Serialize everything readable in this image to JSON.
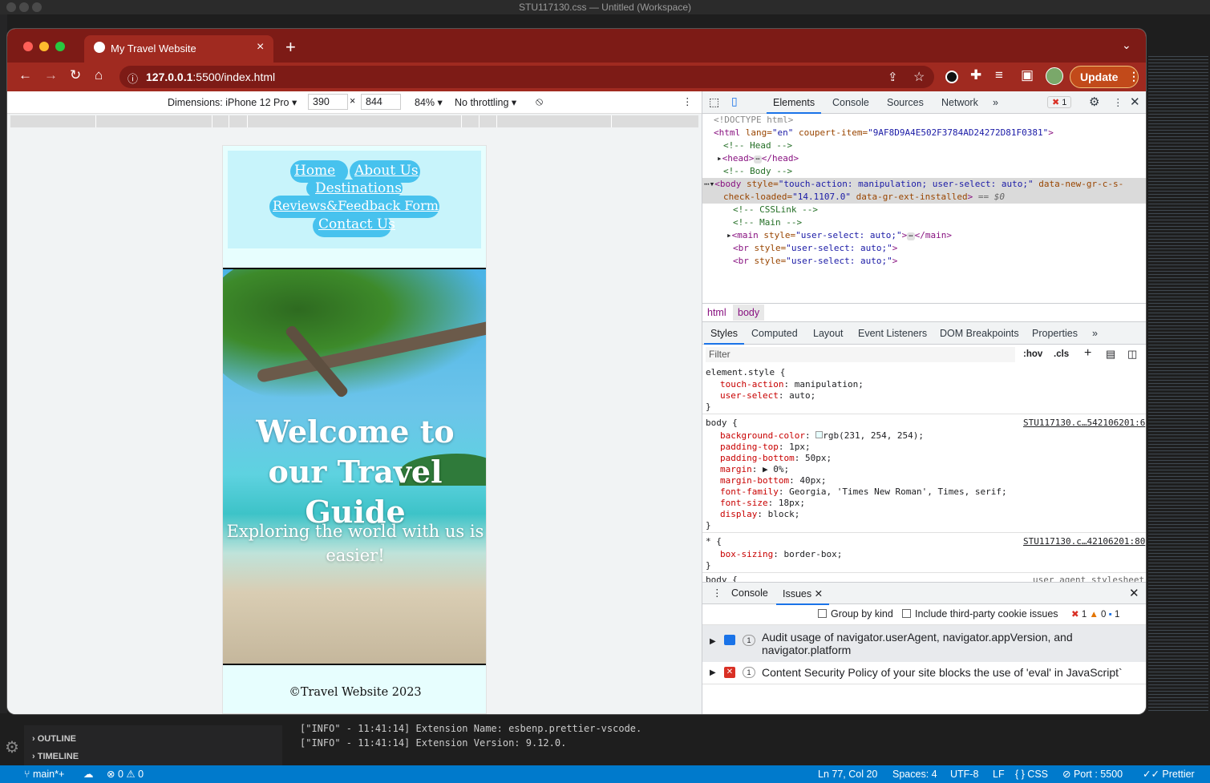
{
  "vscode": {
    "window_title": "STU117130.css — Untitled (Workspace)",
    "outline_label": "OUTLINE",
    "timeline_label": "TIMELINE",
    "terminal_lines": [
      "[\"INFO\" - 11:41:14] Extension Name: esbenp.prettier-vscode.",
      "[\"INFO\" - 11:41:14] Extension Version: 9.12.0."
    ],
    "status": {
      "branch": "main*+",
      "problems": "0",
      "warnings": "0",
      "position": "Ln 77, Col 20",
      "spaces": "Spaces: 4",
      "encoding": "UTF-8",
      "eol": "LF",
      "language": "CSS",
      "port": "Port : 5500",
      "formatter": "Prettier"
    }
  },
  "browser": {
    "tab_title": "My Travel Website",
    "url_host": "127.0.0.1",
    "url_rest": ":5500/index.html",
    "update_label": "Update",
    "device": {
      "dimensions_label": "Dimensions: iPhone 12 Pro",
      "width": "390",
      "height": "844",
      "zoom": "84%",
      "throttling": "No throttling"
    }
  },
  "site": {
    "nav": {
      "home": "Home",
      "about": "About Us",
      "destinations": "Destinations",
      "reviews": "Reviews&Feedback Form",
      "contact": "Contact Us"
    },
    "hero_title": "Welcome to our Travel Guide",
    "hero_subtitle": "Exploring the world with us is easier!",
    "footer": "©Travel Website 2023"
  },
  "devtools": {
    "tabs": [
      "Elements",
      "Console",
      "Sources",
      "Network"
    ],
    "error_count": "1",
    "dom": {
      "doctype": "<!DOCTYPE html>",
      "html_open_tag": "<html",
      "html_lang_attr": " lang=",
      "html_lang_val": "\"en\"",
      "html_coupert_attr": " coupert-item=",
      "html_coupert_val": "\"9AF8D9A4E502F3784AD24272D81F0381\"",
      "html_close": ">",
      "comment_head": "<!-- Head -->",
      "head_open": "<head>",
      "head_close": "</head>",
      "comment_body": "<!-- Body -->",
      "body_open": "<body",
      "body_style_attr": " style=",
      "body_style_val": "\"touch-action: manipulation; user-select: auto;\"",
      "body_gr_attr": " data-new-gr-c-s-",
      "body_gr_attr2": "check-loaded=",
      "body_gr_val": "\"14.1107.0\"",
      "body_ext_attr": " data-gr-ext-installed",
      "body_close": ">",
      "body_eq": " == $0",
      "comment_css": "<!-- CSSLink -->",
      "comment_main": "<!-- Main -->",
      "main_open": "<main",
      "main_style_attr": " style=",
      "main_style_val": "\"user-select: auto;\"",
      "main_close_bracket": ">",
      "main_close_tag": "</main>",
      "br_open": "<br",
      "br_style_attr": " style=",
      "br_style_val": "\"user-select: auto;\"",
      "br_close": ">"
    },
    "breadcrumbs": [
      "html",
      "body"
    ],
    "style_tabs": [
      "Styles",
      "Computed",
      "Layout",
      "Event Listeners",
      "DOM Breakpoints",
      "Properties"
    ],
    "filter_placeholder": "Filter",
    "hov": ":hov",
    "cls": ".cls",
    "rules": {
      "element_selector": "element.style {",
      "element_props": [
        {
          "name": "touch-action",
          "value": "manipulation;"
        },
        {
          "name": "user-select",
          "value": "auto;"
        }
      ],
      "body_selector": "body {",
      "body_source": "STU117130.c…542106201:6",
      "body_props": [
        {
          "name": "background-color",
          "value": "rgb(231, 254, 254);"
        },
        {
          "name": "padding-top",
          "value": "1px;"
        },
        {
          "name": "padding-bottom",
          "value": "50px;"
        },
        {
          "name": "margin",
          "value": "▶ 0%;"
        },
        {
          "name": "margin-bottom",
          "value": "40px;"
        },
        {
          "name": "font-family",
          "value": "Georgia, 'Times New Roman', Times, serif;"
        },
        {
          "name": "font-size",
          "value": "18px;"
        },
        {
          "name": "display",
          "value": "block;"
        }
      ],
      "star_selector": "* {",
      "star_source": "STU117130.c…42106201:80",
      "star_props": [
        {
          "name": "box-sizing",
          "value": "border-box;"
        }
      ],
      "ua_selector": "body {",
      "ua_source": "user agent stylesheet",
      "close_brace": "}"
    },
    "drawer_tabs": [
      "Console",
      "Issues"
    ],
    "group_by_kind": "Group by kind",
    "third_party": "Include third-party cookie issues",
    "issue_counts": {
      "errors": "1",
      "warnings": "0",
      "info": "1"
    },
    "issues": [
      {
        "count": "1",
        "text": "Audit usage of navigator.userAgent, navigator.appVersion, and navigator.platform"
      },
      {
        "count": "1",
        "text": "Content Security Policy of your site blocks the use of 'eval' in JavaScript`"
      }
    ],
    "colors": {
      "accent": "#1a73e8",
      "error": "#d93025",
      "warning": "#e37400"
    }
  }
}
